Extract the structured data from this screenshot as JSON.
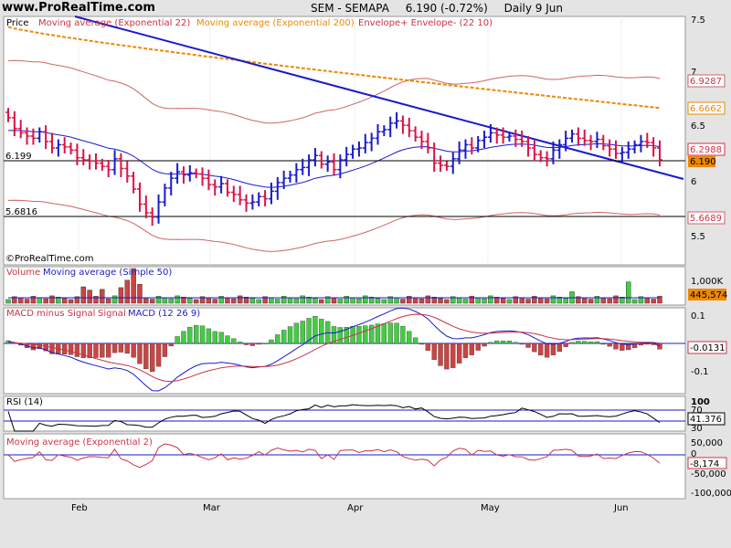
{
  "header": {
    "brand": "www.ProRealTime.com",
    "symbol": "SEM - SEMAPA",
    "quote": "6.190 (-0.72%)",
    "period": "Daily  9 Jun"
  },
  "colors": {
    "up": "#1a1acc",
    "down": "#dd1144",
    "ema22": "#cc3344",
    "ema200": "#ee8800",
    "envelope": "#cc6666",
    "trendline": "#1a1acc",
    "macd_line": "#1a1acc",
    "signal_line": "#cc3344"
  },
  "chart_data": [
    {
      "type": "candlestick",
      "panel": "price",
      "legend": [
        "Price",
        "Moving average (Exponential 22)",
        "Moving average (Exponential 200)",
        "Envelope+ Envelope- (22 10)"
      ],
      "y_ticks": [
        "7.5",
        "7",
        "6.5",
        "6",
        "5.5"
      ],
      "y_range": [
        5.32,
        7.55
      ],
      "x_labels": [
        "Feb",
        "Mar",
        "Apr",
        "May",
        "Jun"
      ],
      "closes": [
        6.58,
        6.48,
        6.44,
        6.41,
        6.39,
        6.45,
        6.36,
        6.3,
        6.33,
        6.31,
        6.28,
        6.21,
        6.19,
        6.18,
        6.16,
        6.13,
        6.1,
        6.2,
        6.11,
        6.04,
        5.92,
        5.78,
        5.7,
        5.66,
        5.8,
        5.93,
        6.02,
        6.08,
        6.05,
        6.07,
        6.06,
        6.02,
        5.96,
        5.94,
        5.97,
        5.89,
        5.87,
        5.82,
        5.79,
        5.8,
        5.85,
        5.83,
        5.9,
        5.98,
        6.02,
        6.05,
        6.1,
        6.12,
        6.19,
        6.23,
        6.15,
        6.17,
        6.1,
        6.19,
        6.24,
        6.29,
        6.3,
        6.35,
        6.39,
        6.45,
        6.47,
        6.53,
        6.55,
        6.51,
        6.46,
        6.4,
        6.36,
        6.3,
        6.16,
        6.14,
        6.13,
        6.2,
        6.28,
        6.33,
        6.3,
        6.37,
        6.4,
        6.44,
        6.42,
        6.4,
        6.41,
        6.38,
        6.36,
        6.3,
        6.24,
        6.21,
        6.2,
        6.28,
        6.33,
        6.39,
        6.43,
        6.39,
        6.37,
        6.36,
        6.38,
        6.32,
        6.29,
        6.25,
        6.26,
        6.29,
        6.33,
        6.36,
        6.35,
        6.3,
        6.19
      ],
      "ema22_last": "6.2988",
      "ema200_last": "6.6662",
      "envelope_upper_last": "6.9287",
      "envelope_lower_last": "5.6689",
      "last_close": "6.190",
      "hline_levels": [
        "6.199",
        "5.6816"
      ]
    },
    {
      "type": "bar",
      "panel": "volume",
      "legend": [
        "Volume",
        "Moving average (Simple 50)"
      ],
      "y_ticks": [
        "1,000K"
      ],
      "last_ma": "445,574"
    },
    {
      "type": "bar",
      "panel": "macd",
      "legend": [
        "MACD minus Signal",
        "Signal",
        "MACD (12 26 9)"
      ],
      "y_ticks": [
        "0.1",
        "0",
        "-0.1"
      ],
      "last_value": "-0.0131"
    },
    {
      "type": "line",
      "panel": "rsi",
      "legend": [
        "RSI (14)"
      ],
      "y_ticks": [
        "100",
        "70",
        "30"
      ],
      "last_value": "41.376"
    },
    {
      "type": "line",
      "panel": "ema2",
      "legend": [
        "Moving average (Exponential 2)"
      ],
      "y_ticks": [
        "50,000",
        "0",
        "-50,000",
        "-100,000"
      ],
      "last_value": "-8,174"
    }
  ],
  "footer": {
    "copyright": "©ProRealTime.com"
  }
}
